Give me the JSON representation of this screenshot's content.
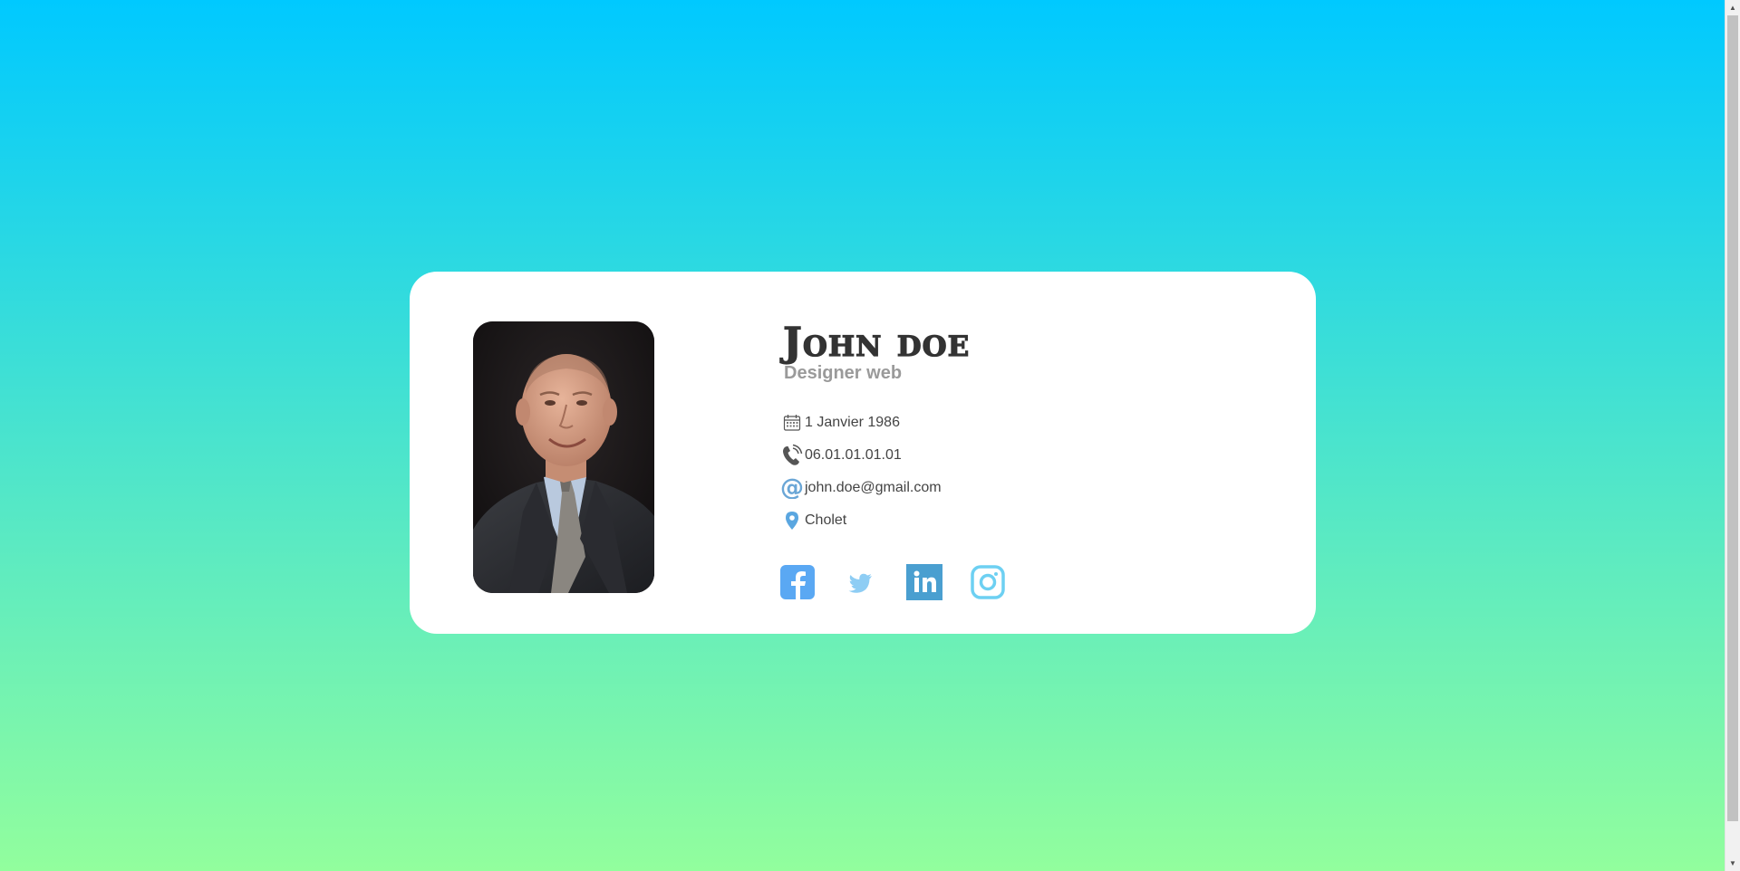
{
  "profile": {
    "name": "John doe",
    "job_title": "Designer web"
  },
  "details": [
    {
      "icon": "calendar-icon",
      "text": "1 Janvier 1986"
    },
    {
      "icon": "phone-icon",
      "text": "06.01.01.01.01"
    },
    {
      "icon": "at-sign-icon",
      "text": "john.doe@gmail.com"
    },
    {
      "icon": "location-pin-icon",
      "text": "Cholet"
    }
  ],
  "social": [
    {
      "name": "facebook-icon",
      "color": "#5aa8f3"
    },
    {
      "name": "twitter-icon",
      "color": "#8ecdf4"
    },
    {
      "name": "linkedin-icon",
      "color": "#4a9fd0"
    },
    {
      "name": "instagram-icon",
      "color": "#6dd0f2"
    }
  ],
  "colors": {
    "gradient_top": "#00c9ff",
    "gradient_bottom": "#92fe9d",
    "card_background": "#ffffff",
    "name_color": "#333333",
    "job_color": "#9a9a9a"
  }
}
